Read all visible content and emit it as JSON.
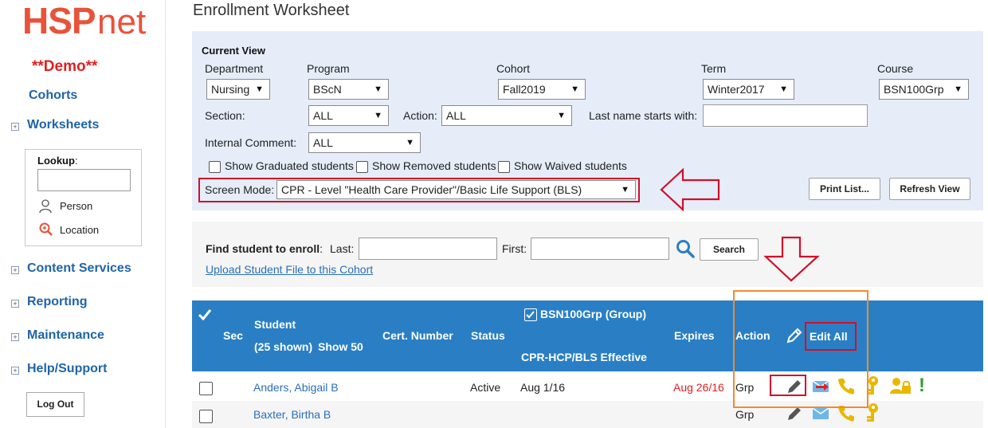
{
  "sidebar": {
    "logo_bold": "HSP",
    "logo_light": "net",
    "demo_label": "**Demo**",
    "nav": {
      "cohorts": "Cohorts",
      "worksheets": "Worksheets",
      "content_services": "Content Services",
      "reporting": "Reporting",
      "maintenance": "Maintenance",
      "help_support": "Help/Support"
    },
    "lookup": {
      "label": "Lookup",
      "colon": ":",
      "value": "",
      "person": "Person",
      "location": "Location"
    },
    "logout_label": "Log Out"
  },
  "page": {
    "title": "Enrollment Worksheet"
  },
  "current_view": {
    "heading": "Current View",
    "department": {
      "label": "Department",
      "value": "Nursing"
    },
    "program": {
      "label": "Program",
      "value": "BScN"
    },
    "cohort": {
      "label": "Cohort",
      "value": "Fall2019"
    },
    "term": {
      "label": "Term",
      "value": "Winter2017"
    },
    "course": {
      "label": "Course",
      "value": "BSN100Grp"
    },
    "section": {
      "label": "Section:",
      "value": "ALL"
    },
    "action": {
      "label": "Action:",
      "value": "ALL"
    },
    "last_name": {
      "label": "Last name starts with:",
      "value": ""
    },
    "internal_comment": {
      "label": "Internal Comment:",
      "value": "ALL"
    },
    "show_graduated": "Show Graduated students",
    "show_removed": "Show Removed students",
    "show_waived": "Show Waived students",
    "screen_mode": {
      "label": "Screen Mode:",
      "value": "CPR - Level \"Health Care Provider\"/Basic Life Support (BLS)"
    },
    "print_list": "Print List...",
    "refresh_view": "Refresh View"
  },
  "find": {
    "label": "Find student to enroll",
    "colon": ":",
    "last_label": "Last:",
    "first_label": "First:",
    "last_value": "",
    "first_value": "",
    "search_label": "Search",
    "upload_link": "Upload Student File to this Cohort"
  },
  "table": {
    "headers": {
      "sec": "Sec",
      "student": "Student",
      "shown": "(25 shown)",
      "show50": "Show 50",
      "cert": "Cert. Number",
      "status": "Status",
      "group": "BSN100Grp  (Group)",
      "effective": "CPR-HCP/BLS Effective",
      "expires": "Expires",
      "action": "Action",
      "edit_all": "Edit All"
    },
    "rows": [
      {
        "student": "Anders, Abigail B",
        "status": "Active",
        "effective": "Aug 1/16",
        "expires": "Aug 26/16",
        "action": "Grp"
      },
      {
        "student": "Baxter, Birtha B",
        "status": "",
        "effective": "",
        "expires": "",
        "action": "Grp"
      }
    ]
  },
  "colors": {
    "brand": "#e8523a",
    "link": "#1f64a8",
    "header_blue": "#2a7fc4",
    "panel_blue": "#e6edf8",
    "highlight_red": "#d0102a",
    "highlight_orange": "#f28a30",
    "expired_red": "#e02020",
    "icon_gold": "#e8b800",
    "icon_green": "#2aa02a"
  }
}
